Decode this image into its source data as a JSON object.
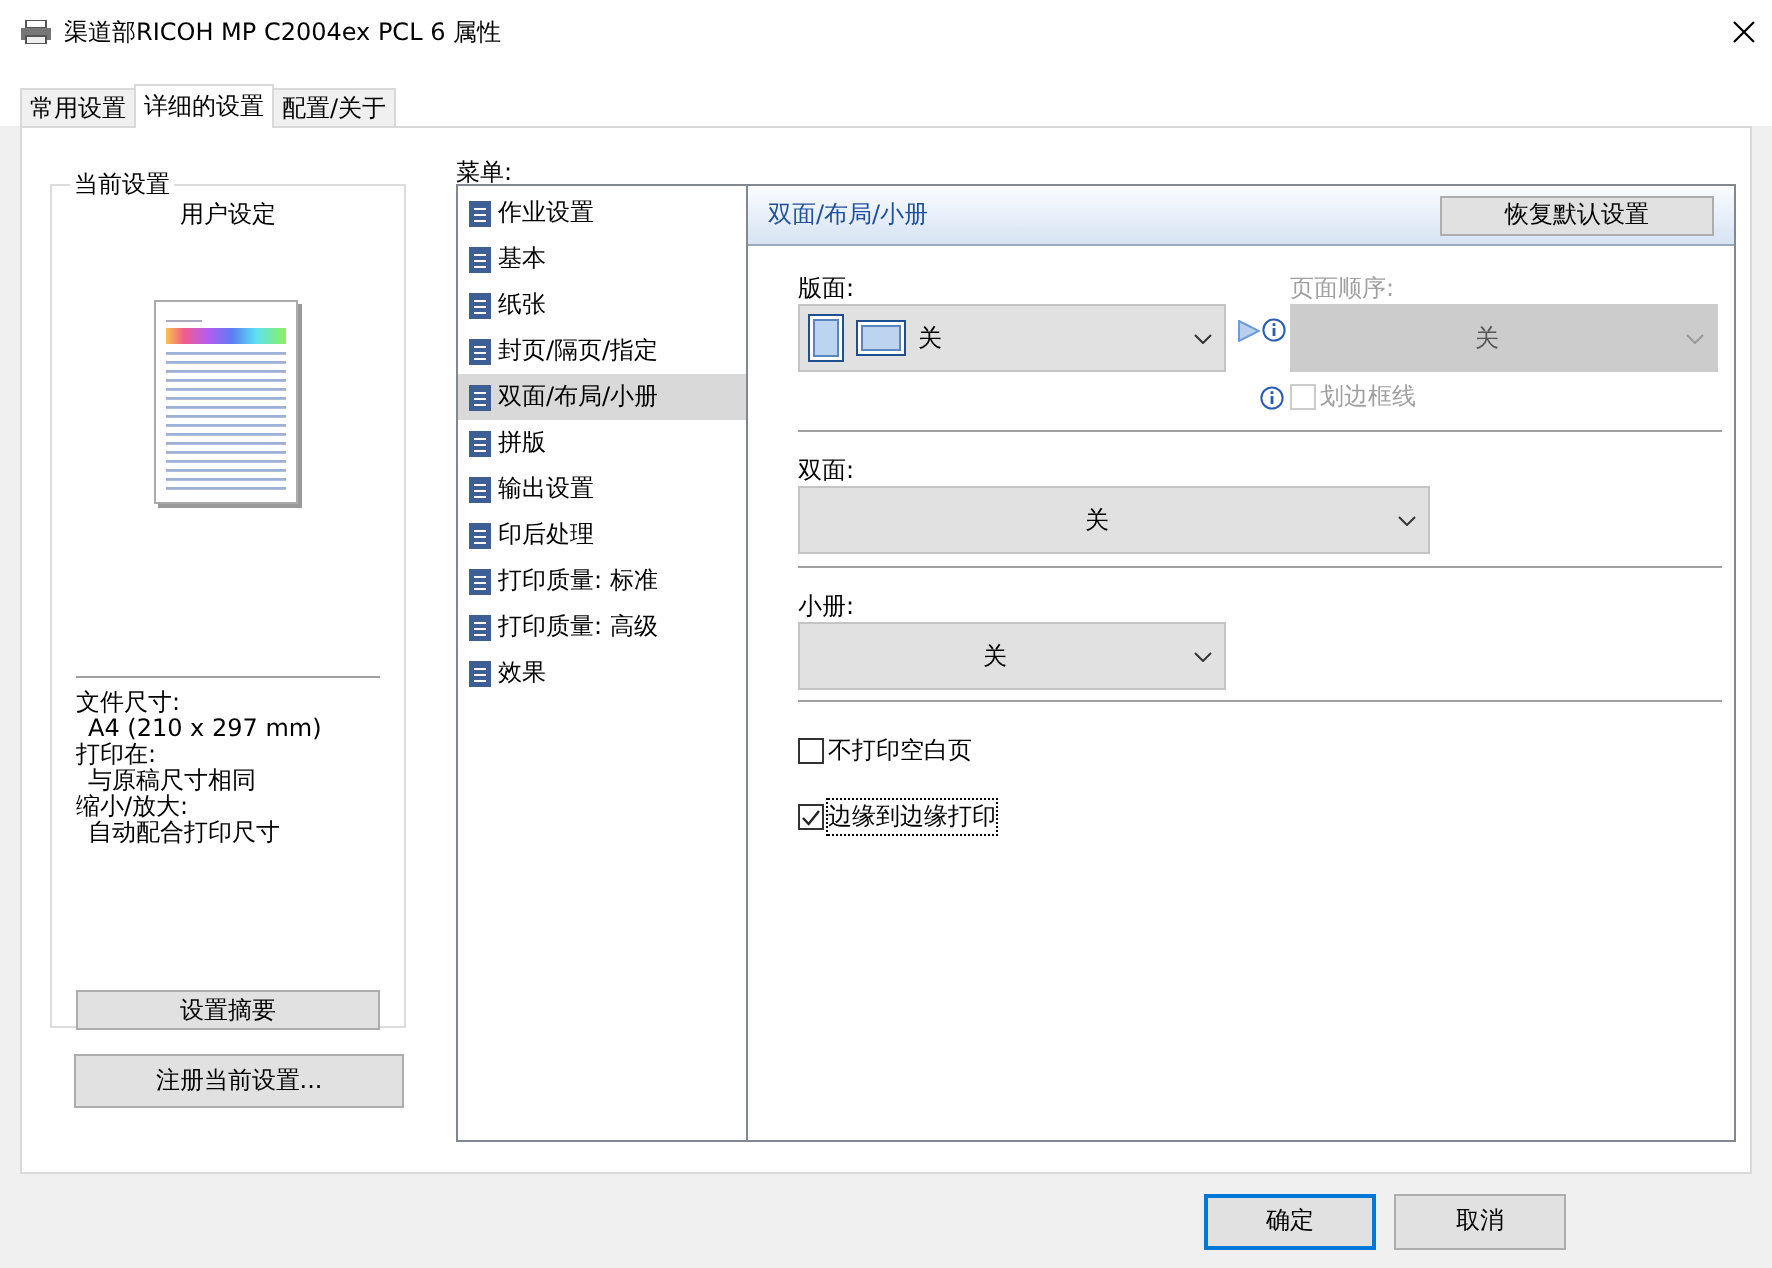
{
  "window": {
    "title": "渠道部RICOH MP C2004ex PCL 6 属性"
  },
  "tabs": [
    {
      "label": "常用设置",
      "selected": false
    },
    {
      "label": "详细的设置",
      "selected": true
    },
    {
      "label": "配置/关于",
      "selected": false
    }
  ],
  "current_settings": {
    "title": "当前设置",
    "profile": "用户设定",
    "details": [
      {
        "label": "文件尺寸:",
        "value": "A4 (210 x 297 mm)"
      },
      {
        "label": "打印在:",
        "value": "与原稿尺寸相同"
      },
      {
        "label": "缩小/放大:",
        "value": "自动配合打印尺寸"
      }
    ],
    "summary_button": "设置摘要"
  },
  "register_button": "注册当前设置...",
  "menu": {
    "label": "菜单:",
    "items": [
      {
        "label": "作业设置",
        "selected": false
      },
      {
        "label": "基本",
        "selected": false
      },
      {
        "label": "纸张",
        "selected": false
      },
      {
        "label": "封页/隔页/指定",
        "selected": false
      },
      {
        "label": "双面/布局/小册",
        "selected": true
      },
      {
        "label": "拼版",
        "selected": false
      },
      {
        "label": "输出设置",
        "selected": false
      },
      {
        "label": "印后处理",
        "selected": false
      },
      {
        "label": "打印质量: 标准",
        "selected": false
      },
      {
        "label": "打印质量: 高级",
        "selected": false
      },
      {
        "label": "效果",
        "selected": false
      }
    ]
  },
  "panel": {
    "title": "双面/布局/小册",
    "reset_button": "恢复默认设置",
    "layout": {
      "label": "版面:",
      "value": "关"
    },
    "page_order": {
      "label": "页面顺序:",
      "value": "关",
      "disabled": true
    },
    "border_lines": {
      "label": "划边框线",
      "checked": false,
      "disabled": true
    },
    "duplex": {
      "label": "双面:",
      "value": "关"
    },
    "booklet": {
      "label": "小册:",
      "value": "关"
    },
    "options": [
      {
        "label": "不打印空白页",
        "checked": false,
        "focused": false
      },
      {
        "label": "边缘到边缘打印",
        "checked": true,
        "focused": true
      }
    ]
  },
  "buttons": [
    {
      "label": "确定",
      "default": true
    },
    {
      "label": "取消",
      "default": false
    }
  ]
}
